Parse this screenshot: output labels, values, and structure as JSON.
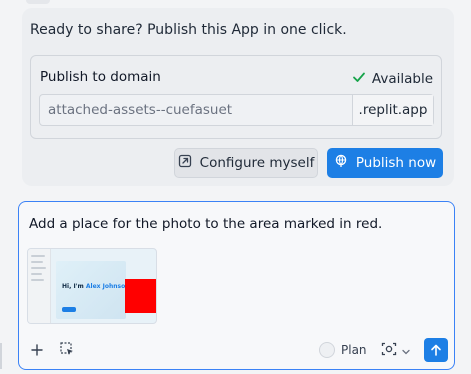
{
  "publish": {
    "message": "Ready to share? Publish this App in one click.",
    "domain_title": "Publish to domain",
    "availability": "Available",
    "domain_value": "attached-assets--cuefasuet",
    "domain_suffix": ".replit.app",
    "configure_label": "Configure myself",
    "publish_label": "Publish now"
  },
  "composer": {
    "prompt": "Add a place for the photo to the area marked in red.",
    "attachment": {
      "heading_prefix": "Hi, I'm",
      "heading_name": "Alex Johnson"
    },
    "plan_label": "Plan"
  },
  "colors": {
    "accent": "#1d7fe5",
    "highlight": "#ff0000",
    "available_check": "#16a34a"
  }
}
